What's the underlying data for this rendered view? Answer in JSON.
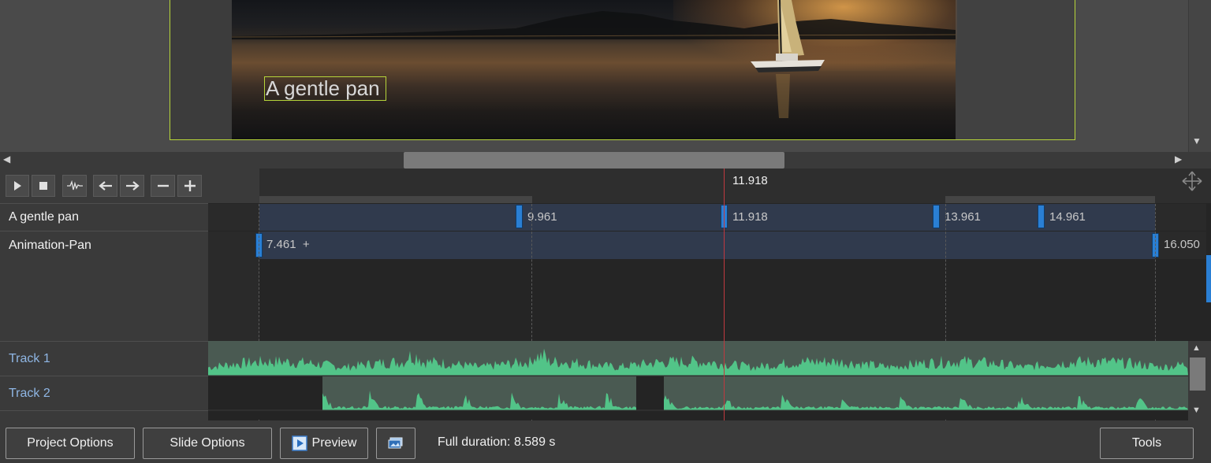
{
  "preview": {
    "text_overlay": "A gentle pan"
  },
  "timeline": {
    "cursor_time": "11.918",
    "rows": [
      {
        "label": "A gentle pan",
        "markers": [
          "9.961",
          "11.918",
          "13.961",
          "14.961"
        ]
      },
      {
        "label": "Animation-Pan",
        "start_label": "7.461  +",
        "end_label": "16.050"
      }
    ],
    "audio_tracks": [
      {
        "label": "Track 1"
      },
      {
        "label": "Track 2"
      }
    ]
  },
  "toolbar": {
    "icons": [
      "play-icon",
      "stop-icon",
      "waveform-icon",
      "arrow-left-icon",
      "arrow-right-icon",
      "minus-icon",
      "plus-icon"
    ]
  },
  "bottom_bar": {
    "project_options": "Project Options",
    "slide_options": "Slide Options",
    "preview": "Preview",
    "full_duration": "Full duration: 8.589 s",
    "tools": "Tools"
  },
  "colors": {
    "accent_blue": "#2a7fd4",
    "selection_green": "#b7d53a",
    "cursor_red": "#c0393f",
    "wave_green": "#52c488",
    "track_label_blue": "#8fb6e4"
  }
}
